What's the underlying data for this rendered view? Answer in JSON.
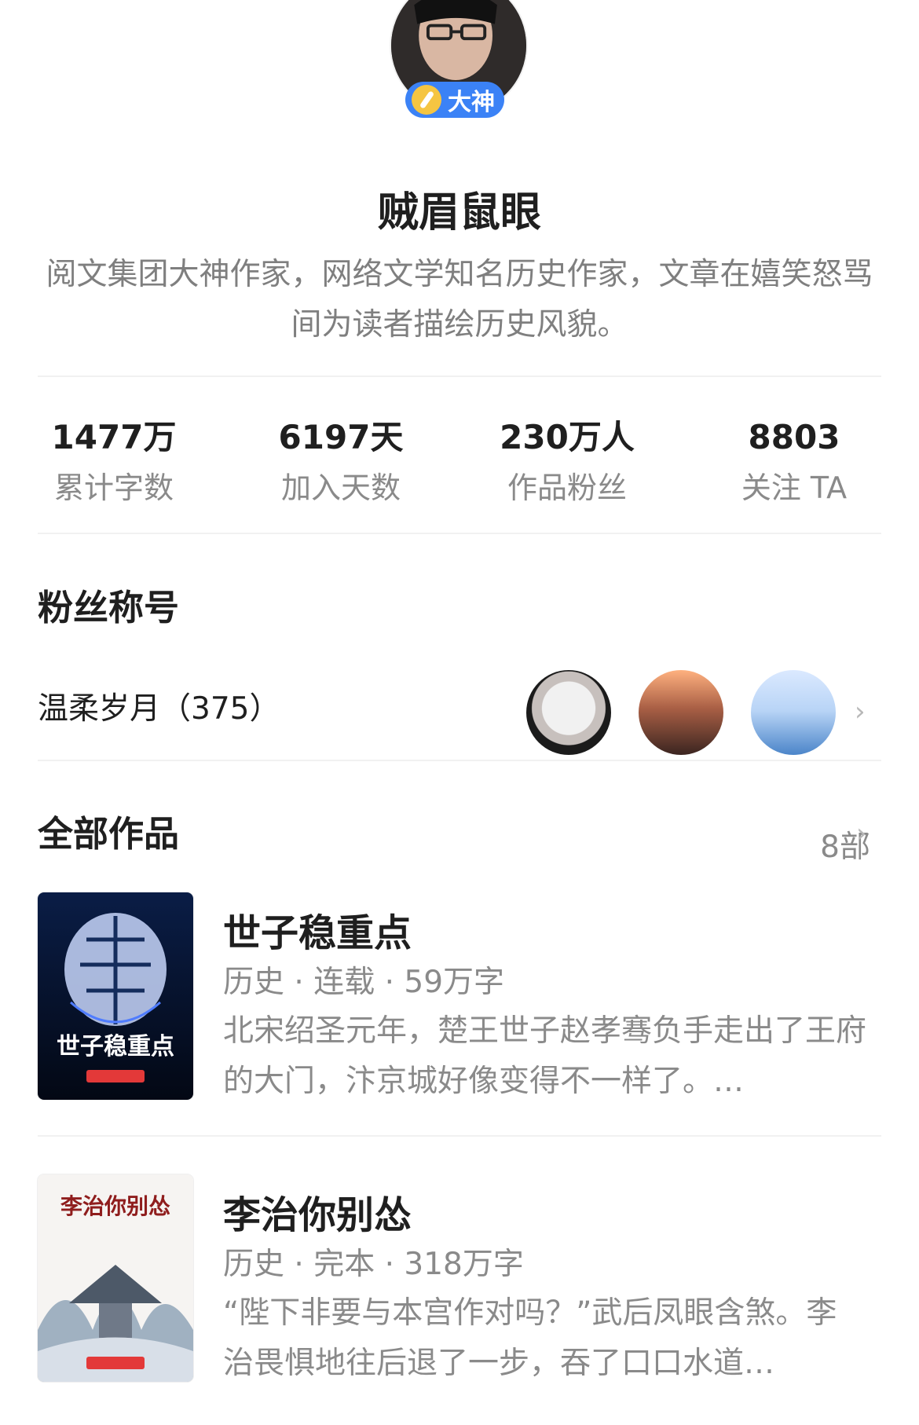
{
  "profile": {
    "name": "贼眉鼠眼",
    "badge": "大神",
    "intro": "阅文集团大神作家，网络文学知名历史作家，文章在嬉笑怒骂间为读者描绘历史风貌。"
  },
  "stats": [
    {
      "value": "1477万",
      "label": "累计字数"
    },
    {
      "value": "6197天",
      "label": "加入天数"
    },
    {
      "value": "230万人",
      "label": "作品粉丝"
    },
    {
      "value": "8803",
      "label": "关注 TA"
    }
  ],
  "fans": {
    "title": "粉丝称号",
    "row_label": "温柔岁月（375）"
  },
  "works": {
    "title": "全部作品",
    "count": "8部",
    "items": [
      {
        "title": "世子稳重点",
        "meta": "历史 · 连载 · 59万字",
        "desc": "北宋绍圣元年，楚王世子赵孝骞负手走出了王府的大门，汴京城好像变得不一样了。…",
        "cover_text": "世子稳重点"
      },
      {
        "title": "李治你别怂",
        "meta": "历史 · 完本 · 318万字",
        "desc": "“陛下非要与本宫作对吗？”武后凤眼含煞。李治畏惧地往后退了一步，吞了口口水道…",
        "cover_text": "李治你别怂"
      }
    ]
  },
  "icons": {
    "badge": "pen-icon",
    "chevron": "chevron-right-icon"
  }
}
